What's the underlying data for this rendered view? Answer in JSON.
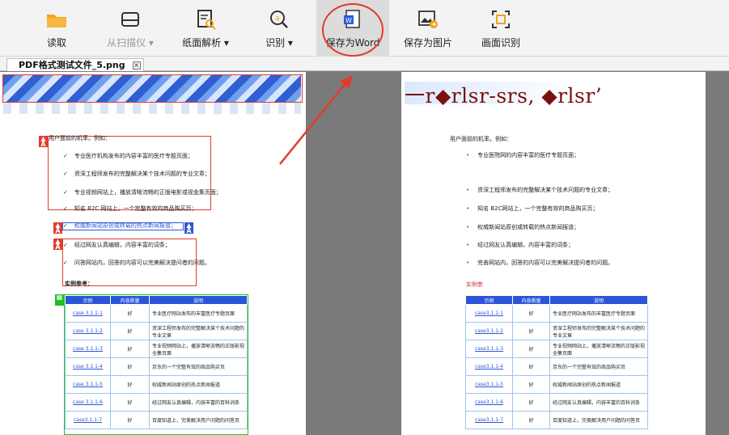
{
  "toolbar": {
    "buttons": [
      {
        "label": "读取",
        "icon": "folder-icon",
        "state": "normal"
      },
      {
        "label": "从扫描仪 ▾",
        "icon": "scanner-icon",
        "state": "disabled"
      },
      {
        "label": "纸面解析 ▾",
        "icon": "page-analyze-icon",
        "state": "normal"
      },
      {
        "label": "识别 ▾",
        "icon": "recognize-icon",
        "state": "normal"
      },
      {
        "label": "保存为Word",
        "icon": "word-icon",
        "state": "active"
      },
      {
        "label": "保存为图片",
        "icon": "save-image-icon",
        "state": "normal"
      },
      {
        "label": "画面识别",
        "icon": "screen-recognize-icon",
        "state": "normal"
      }
    ],
    "accent": "#f4a21e",
    "highlight_color": "#e23b2e"
  },
  "tab": {
    "label": "PDF格式测试文件_5.png",
    "close": "×"
  },
  "left_page": {
    "intro": "用户面前的机率。例如：",
    "bullets": [
      "专业医疗机构发布的内容丰富的医疗专题页面；",
      "资深工程师发布的完整解决某个技术问题的专业文章；",
      "专业视频网站上，播放清晰流畅的正版电影或视金集页面；",
      "知名 B2C 网站上，一个完整有效的商品购买页；",
      "权威新闻站原创或转载的热点新闻报道；",
      "经过网友认真编辑，内容丰富的词条；",
      "问答网站内，回答的内容可以完美解决提问者的问题。"
    ],
    "section": "实例参考：",
    "table": {
      "headers": [
        "示例",
        "内容质量",
        "说明"
      ],
      "rows": [
        [
          "case 3.1.1-1",
          "好",
          "专业医疗网站发布的丰富医疗专题页面"
        ],
        [
          "case 3.1.1-2",
          "好",
          "资深工程师发布的完整解决某个技术问题的专业文章"
        ],
        [
          "case 3.1.1-3",
          "好",
          "专业视频网站上，播放清晰流畅的正版影视全集页面"
        ],
        [
          "case 3.1.1-4",
          "好",
          "京东的一个完整有效的商品购买页"
        ],
        [
          "case 3.1.1-5",
          "好",
          "权威新闻站原创的热点新闻报道"
        ],
        [
          "case 3.1.1-6",
          "好",
          "经过网友认真编辑，内容丰富的百科词条"
        ],
        [
          "case3.1.1-7",
          "好",
          "百度知道上，完美解决用户问题的问答页"
        ]
      ],
      "header_color": "#2b55d9"
    }
  },
  "right_page": {
    "title": "一r◆rlsr-srs, ◆rlsr’",
    "intro": "用户面前的机率。例如：",
    "bullets": [
      "专业医院网的内容丰富的医疗专题页面；",
      "资深工程师发布的完整解决某个技术问题的专业文章；",
      "知名 B2C网站上，一个完整有效的商品购买页；",
      "权威新闻站原创或转载的热点新闻报道；",
      "经过网友认真编辑，内容丰富的词条；",
      "完善网站内，回答的内容可以完美解决提问者的问题。"
    ],
    "section": "实例参",
    "table": {
      "headers": [
        "示例",
        "内容质量",
        "说明"
      ],
      "rows": [
        [
          "case3.1.1-1",
          "好",
          "专业医疗网站发布的丰富医疗专题页面"
        ],
        [
          "case3.1.1-2",
          "好",
          "资深工程师发布的完整解决某个技术问题的专业文章"
        ],
        [
          "case3.1.1-3",
          "好",
          "专业视频网站上，播放清晰流畅的正版影视全集页面"
        ],
        [
          "case3.1.1-4",
          "好",
          "京东的一个完整有效的商品购买页"
        ],
        [
          "case3.1.1-5",
          "好",
          "权威新闻站原创的热点新闻报道"
        ],
        [
          "case3.1.1-6",
          "好",
          "经过网友认真编辑，内容丰富的百科词条"
        ],
        [
          "case3.1.1-7",
          "好",
          "百度知道上，完美解决用户问题的问答页"
        ]
      ],
      "header_color": "#2b55d9"
    }
  }
}
